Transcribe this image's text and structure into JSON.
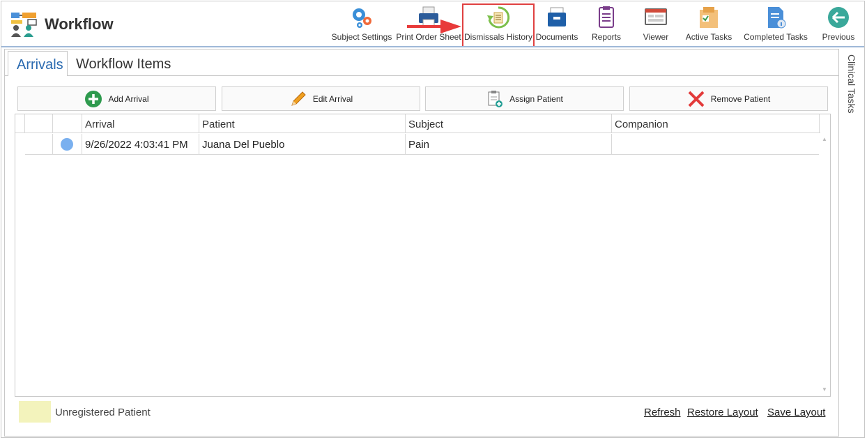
{
  "app": {
    "title": "Workflow",
    "logo_icon": "workflow-logo-icon"
  },
  "toolbar": {
    "highlight_color": "#e04040",
    "buttons": [
      {
        "label": "Subject Settings",
        "icon": "gear-settings-icon"
      },
      {
        "label": "Print Order Sheet",
        "icon": "printer-icon"
      },
      {
        "label": "Dismissals History",
        "icon": "history-icon"
      },
      {
        "label": "Documents",
        "icon": "document-tray-icon"
      },
      {
        "label": "Reports",
        "icon": "report-icon"
      },
      {
        "label": "Viewer",
        "icon": "viewer-icon"
      },
      {
        "label": "Active Tasks",
        "icon": "active-tasks-icon"
      },
      {
        "label": "Completed Tasks",
        "icon": "completed-tasks-icon"
      },
      {
        "label": "Previous",
        "icon": "back-arrow-icon"
      }
    ]
  },
  "tabs": [
    {
      "label": "Arrivals",
      "active": true
    },
    {
      "label": "Workflow Items",
      "active": false
    }
  ],
  "side_panel": {
    "label": "Clinical Tasks"
  },
  "actions": [
    {
      "label": "Add Arrival",
      "icon": "add-circle-icon"
    },
    {
      "label": "Edit Arrival",
      "icon": "pencil-icon"
    },
    {
      "label": "Assign Patient",
      "icon": "assign-clipboard-icon"
    },
    {
      "label": "Remove Patient",
      "icon": "remove-x-icon"
    }
  ],
  "grid": {
    "columns": [
      "Arrival",
      "Patient",
      "Subject",
      "Companion"
    ],
    "rows": [
      {
        "status_color": "#7ab0ef",
        "arrival": "9/26/2022 4:03:41 PM",
        "patient": "Juana Del Pueblo",
        "subject": "Pain",
        "companion": ""
      }
    ]
  },
  "legend": {
    "label": "Unregistered Patient",
    "color": "#f3f3bc"
  },
  "footer_links": {
    "refresh": "Refresh",
    "restore": "Restore Layout",
    "save": "Save Layout"
  }
}
